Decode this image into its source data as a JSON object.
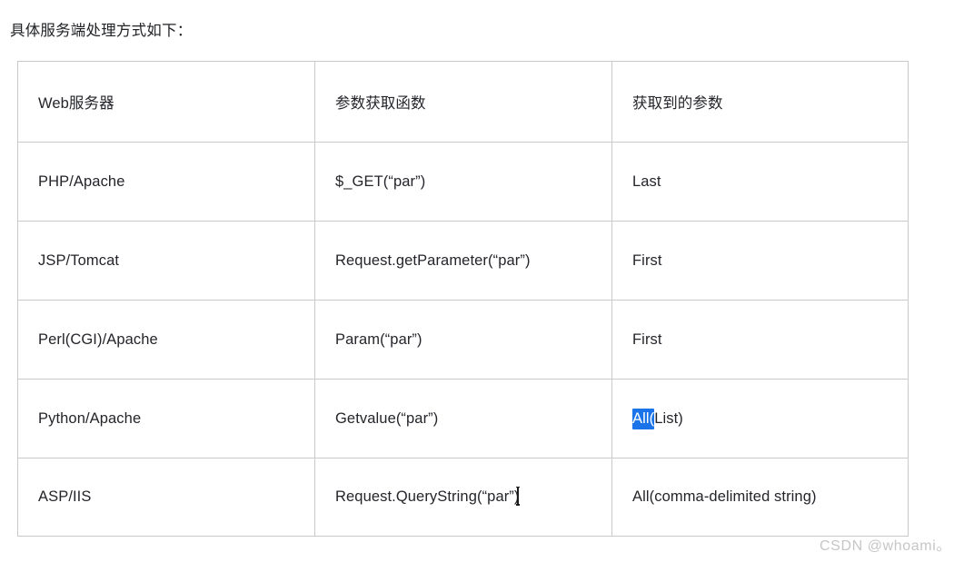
{
  "intro": {
    "text": "具体服务端处理方式如下："
  },
  "table": {
    "headers": [
      "Web服务器",
      "参数获取函数",
      "获取到的参数"
    ],
    "rows": [
      {
        "server": "PHP/Apache",
        "function": "$_GET(“par”)",
        "result_prefix": "",
        "result_selected": "",
        "result_suffix": "Last"
      },
      {
        "server": "JSP/Tomcat",
        "function": "Request.getParameter(“par”)",
        "result_prefix": "",
        "result_selected": "",
        "result_suffix": "First"
      },
      {
        "server": "Perl(CGI)/Apache",
        "function": "Param(“par”)",
        "result_prefix": "",
        "result_selected": "",
        "result_suffix": "First"
      },
      {
        "server": "Python/Apache",
        "function": "Getvalue(“par”)",
        "result_prefix": "",
        "result_selected": "All(",
        "result_suffix": "List)"
      },
      {
        "server": "ASP/IIS",
        "function": "Request.QueryString(“par”)",
        "result_prefix": "",
        "result_selected": "",
        "result_suffix": "All(comma-delimited string)"
      }
    ]
  },
  "selection": {
    "highlight_color": "#1a73e8",
    "highlight_text_color": "#ffffff"
  },
  "cursor": {
    "type": "text-ibeam-cursor"
  },
  "watermark": {
    "text": "CSDN @whoami。"
  },
  "colors": {
    "border": "#c9c9cc",
    "text": "#24252a",
    "watermark": "#c6c6c8"
  }
}
